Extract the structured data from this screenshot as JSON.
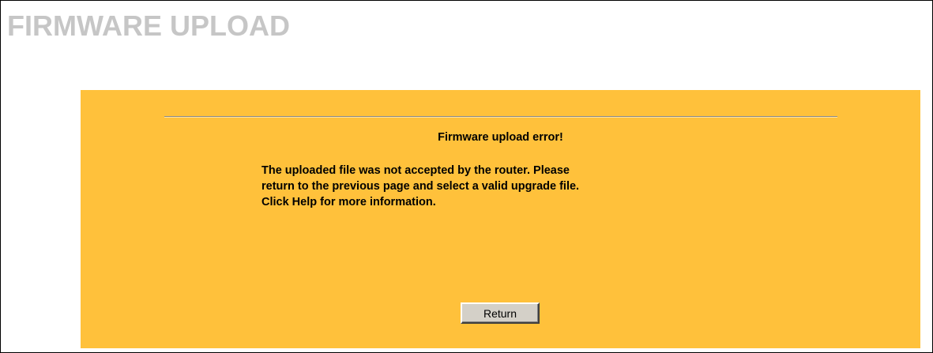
{
  "page": {
    "title": "FIRMWARE UPLOAD"
  },
  "error": {
    "heading": "Firmware upload error!",
    "message_lines": [
      "The uploaded file was not accepted by the router. Please",
      "return to the previous page and select a valid upgrade file.",
      "Click Help for more information."
    ]
  },
  "actions": {
    "return_label": "Return"
  },
  "colors": {
    "panel_background": "#ffc13b",
    "title_text": "#c6c6c6",
    "button_face": "#d4d0c8"
  }
}
